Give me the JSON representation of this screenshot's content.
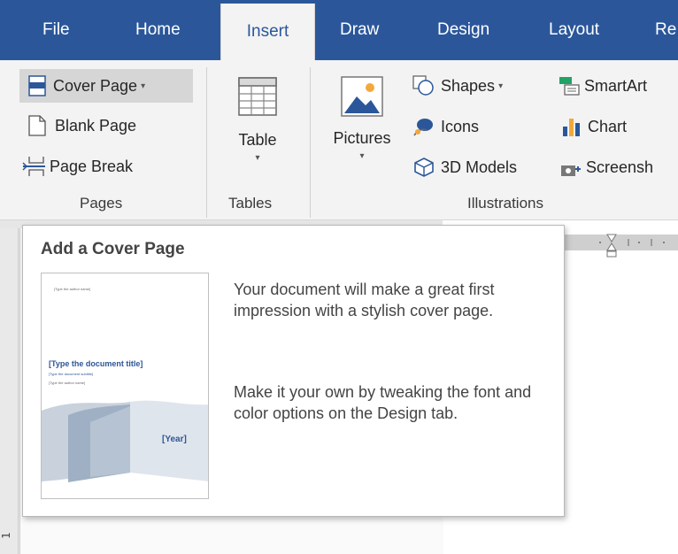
{
  "tabs": [
    {
      "label": "File"
    },
    {
      "label": "Home"
    },
    {
      "label": "Insert"
    },
    {
      "label": "Draw"
    },
    {
      "label": "Design"
    },
    {
      "label": "Layout"
    },
    {
      "label": "Re"
    }
  ],
  "ribbon": {
    "pages": {
      "cover_page": "Cover Page",
      "blank_page": "Blank Page",
      "page_break": "Page Break",
      "group_label": "Pages"
    },
    "tables": {
      "table": "Table",
      "group_label": "Tables"
    },
    "illustrations": {
      "pictures": "Pictures",
      "shapes": "Shapes",
      "icons": "Icons",
      "models_3d": "3D Models",
      "smartart": "SmartArt",
      "chart": "Chart",
      "screenshot": "Screensh",
      "group_label": "Illustrations"
    }
  },
  "tooltip": {
    "title": "Add a Cover Page",
    "paragraph1": "Your document will make a great first impression with a stylish cover page.",
    "paragraph2": "Make it your own by tweaking the font and color options on the Design tab.",
    "thumbnail": {
      "author_top": "[Type the author name]",
      "doc_title": "[Type the document title]",
      "doc_subtitle": "[Type the document subtitle]",
      "author_bottom": "[Type the author name]",
      "year": "[Year]"
    }
  },
  "ruler": {
    "vertical_number": "1"
  },
  "colors": {
    "tab_bar": "#2b579a",
    "ribbon_bg": "#f3f3f3",
    "selected_bg": "#d6d6d6",
    "thumb_accent": "#2e5597"
  }
}
